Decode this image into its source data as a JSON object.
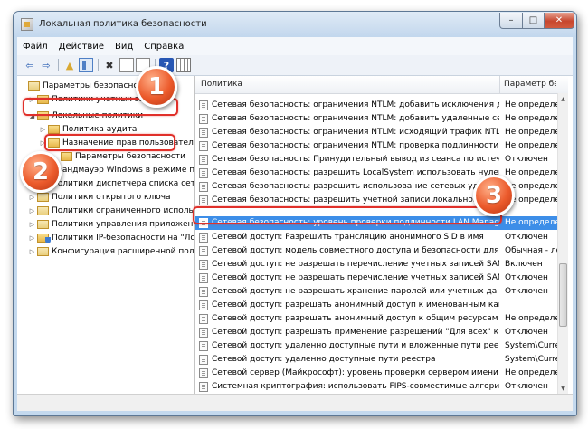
{
  "window": {
    "title": "Локальная политика безопасности",
    "minimize_glyph": "–",
    "maximize_glyph": "□",
    "close_glyph": "✕"
  },
  "menu": {
    "items": [
      "Файл",
      "Действие",
      "Вид",
      "Справка"
    ]
  },
  "toolbar": {
    "back_glyph": "⇦",
    "forward_glyph": "⇨",
    "up_glyph": "▲",
    "delete_glyph": "✖",
    "help_glyph": "?"
  },
  "tree": {
    "items": [
      {
        "label": "Параметры безопасности",
        "arrow": ""
      },
      {
        "label": "Политики учетных записей",
        "arrow": "▷"
      },
      {
        "label": "Локальные политики",
        "arrow": "◢"
      },
      {
        "label": "Политика аудита",
        "arrow": "▷"
      },
      {
        "label": "Назначение прав пользователя",
        "arrow": "▷"
      },
      {
        "label": "Параметры безопасности",
        "arrow": ""
      },
      {
        "label": "Брандмауэр Windows в режиме повышенной безопасности",
        "arrow": "▷"
      },
      {
        "label": "Политики диспетчера списка сетей",
        "arrow": ""
      },
      {
        "label": "Политики открытого ключа",
        "arrow": "▷"
      },
      {
        "label": "Политики ограниченного использования программ",
        "arrow": "▷"
      },
      {
        "label": "Политики управления приложениями",
        "arrow": "▷"
      },
      {
        "label": "Политики IP-безопасности на \"Локальный компьютер\"",
        "arrow": "▷"
      },
      {
        "label": "Конфигурация расширенной политики аудита",
        "arrow": "▷"
      }
    ]
  },
  "list": {
    "headers": {
      "policy": "Политика",
      "setting": "Параметр безопасности"
    },
    "rows": [
      {
        "name": "Сетевая безопасность: ограничения NTLM: добавить исключения для серверов",
        "value": "Не определено"
      },
      {
        "name": "Сетевая безопасность: ограничения NTLM: добавить удаленные серверы для проверки",
        "value": "Не определено"
      },
      {
        "name": "Сетевая безопасность: ограничения NTLM: исходящий трафик NTLM к удаленным серверам",
        "value": "Не определено"
      },
      {
        "name": "Сетевая безопасность: ограничения NTLM: проверка подлинности NTLM в этом домене",
        "value": "Не определено"
      },
      {
        "name": "Сетевая безопасность: Принудительный вывод из сеанса по истечении допустимых часов работы",
        "value": "Отключен"
      },
      {
        "name": "Сетевая безопасность: разрешить LocalSystem использовать нулевые сеансы",
        "value": "Не определено"
      },
      {
        "name": "Сетевая безопасность: разрешить использование сетевых удостоверений",
        "value": "Не определено"
      },
      {
        "name": "Сетевая безопасность: разрешить учетной записи локальной системы использовать удостоверение компьютера для NTLM",
        "value": "Не определено"
      },
      {
        "name": "Сетевая безопасность: уровень проверки подлинности LAN Manager",
        "value": "Не определено"
      },
      {
        "name": "Сетевой доступ: Разрешить трансляцию анонимного SID в имя",
        "value": "Отключен"
      },
      {
        "name": "Сетевой доступ: модель совместного доступа и безопасности для локальных учетных записей",
        "value": "Обычная - локальные"
      },
      {
        "name": "Сетевой доступ: не разрешать перечисление учетных записей SAM анонимными пользователями",
        "value": "Включен"
      },
      {
        "name": "Сетевой доступ: не разрешать перечисление учетных записей SAM и общих ресурсов",
        "value": "Отключен"
      },
      {
        "name": "Сетевой доступ: не разрешать хранение паролей или учетных данных для сетевой проверки",
        "value": "Отключен"
      },
      {
        "name": "Сетевой доступ: разрешать анонимный доступ к именованным каналам",
        "value": ""
      },
      {
        "name": "Сетевой доступ: разрешать анонимный доступ к общим ресурсам",
        "value": "Не определено"
      },
      {
        "name": "Сетевой доступ: разрешать применение разрешений \"Для всех\" к анонимным пользователям",
        "value": "Отключен"
      },
      {
        "name": "Сетевой доступ: удаленно доступные пути и вложенные пути реестра",
        "value": "System\\CurrentControlSet"
      },
      {
        "name": "Сетевой доступ: удаленно доступные пути реестра",
        "value": "System\\CurrentControlSet"
      },
      {
        "name": "Сетевой сервер (Майкрософт): уровень проверки сервером имени участника-службы",
        "value": "Не определено"
      },
      {
        "name": "Системная криптография: использовать FIPS-совместимые алгоритмы для шифрования",
        "value": "Отключен"
      }
    ]
  },
  "annotations": {
    "badge_1": "1",
    "badge_2": "2",
    "badge_3": "3",
    "color": "#e0302a"
  }
}
